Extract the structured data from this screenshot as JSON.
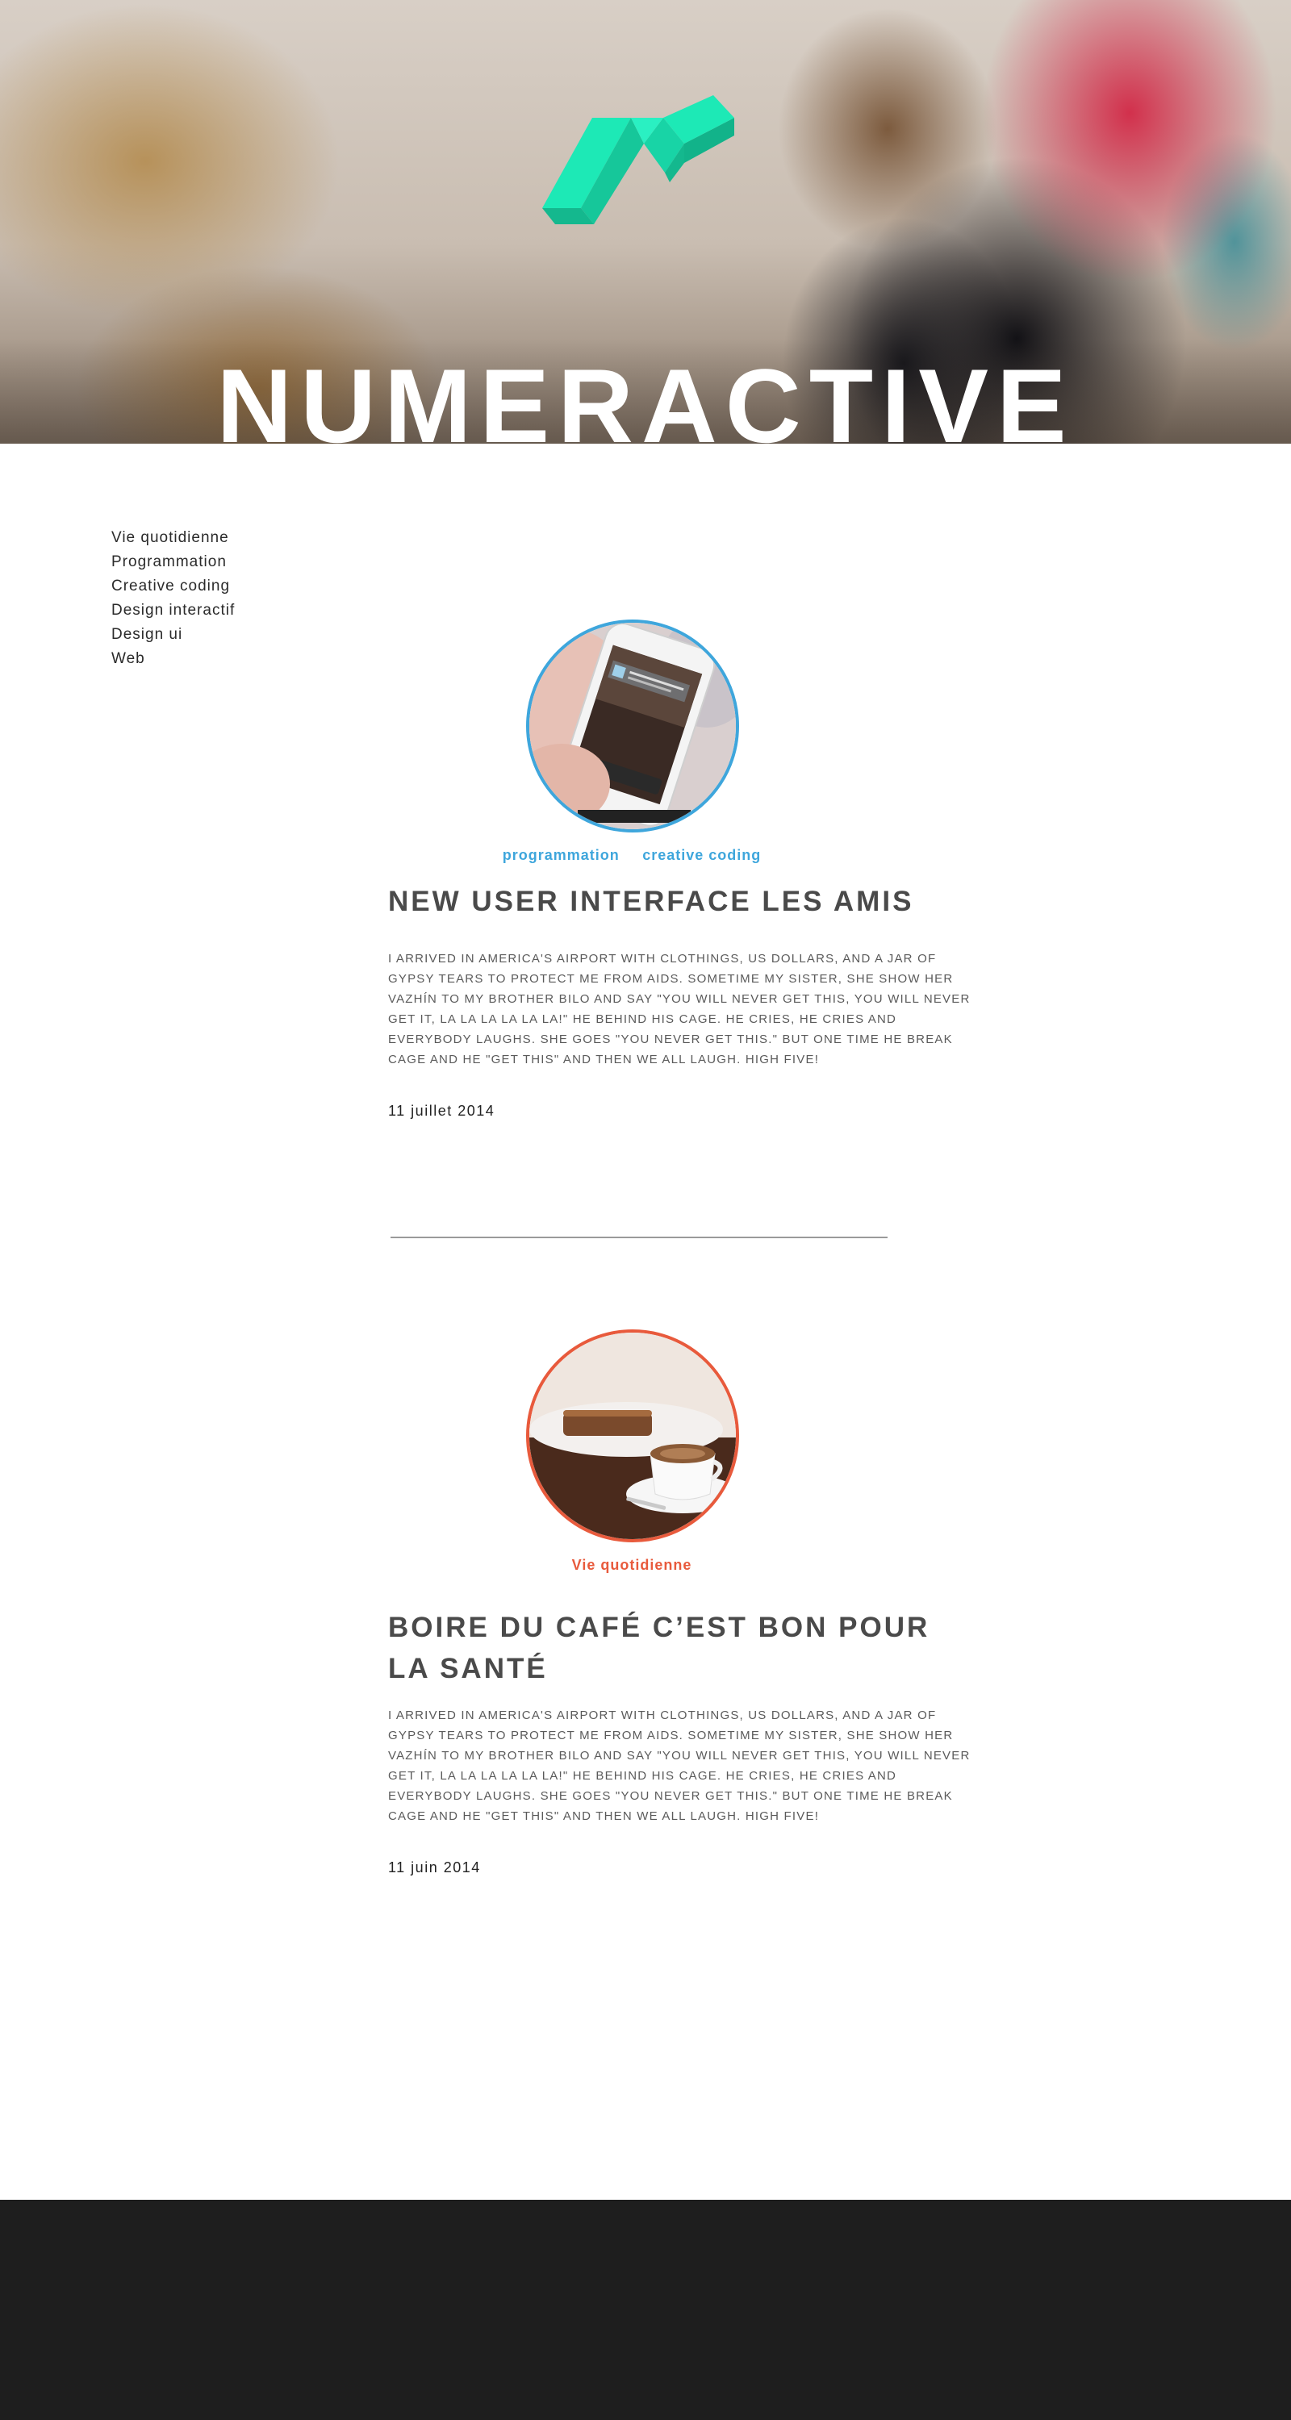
{
  "site": {
    "title": "NUMERACTIVE",
    "accent_color": "#1de9b6"
  },
  "nav": {
    "items": [
      {
        "label": "Vie quotidienne"
      },
      {
        "label": "Programmation"
      },
      {
        "label": "Creative coding"
      },
      {
        "label": "Design interactif"
      },
      {
        "label": "Design ui"
      },
      {
        "label": "Web"
      }
    ]
  },
  "posts": [
    {
      "image": "phone-notification-photo",
      "tags": [
        "programmation",
        "creative coding"
      ],
      "tag_color": "#3ea6dc",
      "title": "NEW USER INTERFACE LES AMIS",
      "excerpt": "I arrived in America's airport with clothings, US dollars, and a jar of gypsy tears to protect me from AIDS. Sometime my sister, she show her vazhín to my brother Bilo and say \"You will never get this, you will never get it, la la la la la la!\" He behind his cage. He cries, he cries and everybody laughs. She goes \"You never get this.\" But one time he break cage and he \"get this\" and then we all laugh. High five!",
      "date": "11 juillet 2014"
    },
    {
      "image": "coffee-cup-photo",
      "tags": [
        "Vie quotidienne"
      ],
      "tag_color": "#e85a3c",
      "title": "BOIRE DU CAFÉ C’EST BON POUR LA SANTÉ",
      "excerpt": "I arrived in America's airport with clothings, US dollars, and a jar of gypsy tears to protect me from AIDS. Sometime my sister, she show her vazhín to my brother Bilo and say \"You will never get this, you will never get it, la la la la la la!\" He behind his cage. He cries, he cries and everybody laughs. She goes \"You never get this.\" But one time he break cage and he \"get this\" and then we all laugh. High five!",
      "date": "11 juin 2014"
    }
  ]
}
